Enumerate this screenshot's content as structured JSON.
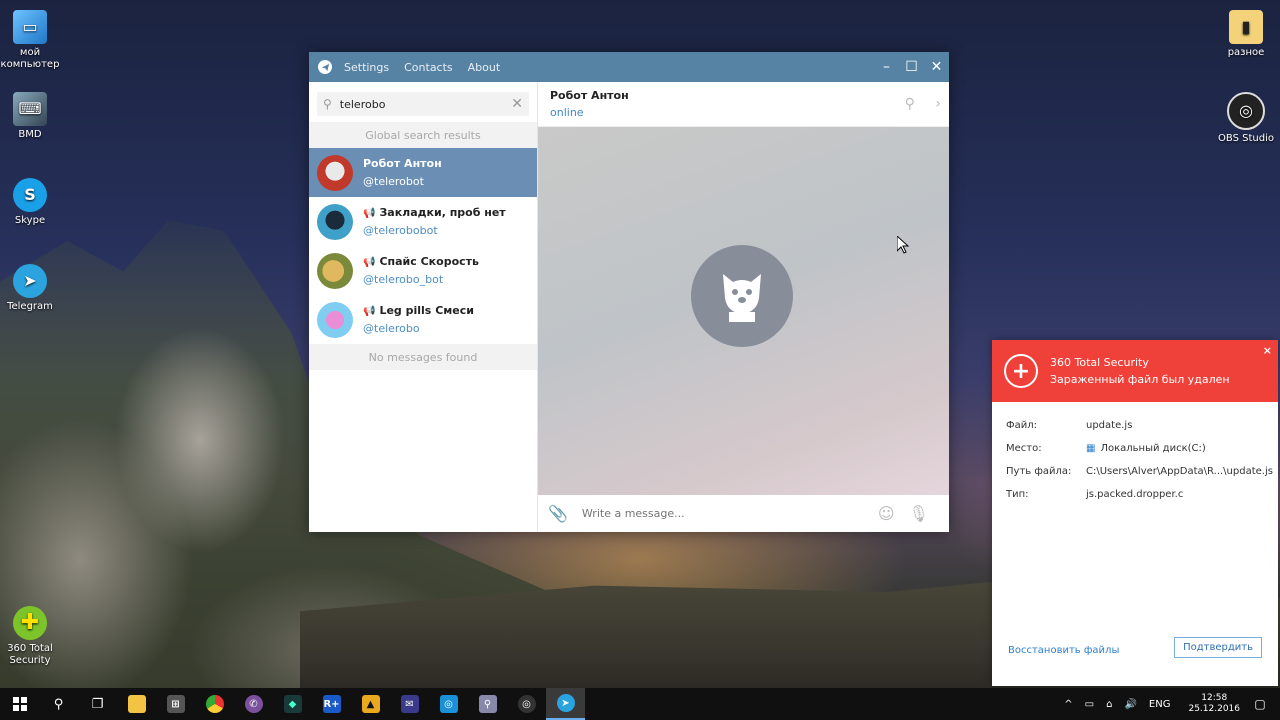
{
  "desktop": {
    "icons_left": [
      {
        "label": "мой компьютер",
        "icon": "computer-icon"
      },
      {
        "label": "BMD",
        "icon": "keyboard-icon"
      },
      {
        "label": "Skype",
        "icon": "skype-icon"
      },
      {
        "label": "Telegram",
        "icon": "telegram-icon"
      },
      {
        "label": "360 Total Security",
        "icon": "security-icon"
      }
    ],
    "icons_right": [
      {
        "label": "разное",
        "icon": "folder-icon"
      },
      {
        "label": "OBS Studio",
        "icon": "obs-icon"
      }
    ]
  },
  "telegram": {
    "menu": {
      "settings": "Settings",
      "contacts": "Contacts",
      "about": "About"
    },
    "search": {
      "value": "telerobo"
    },
    "global_header": "Global search results",
    "results": [
      {
        "name": "Робот Антон",
        "username": "@telerobot",
        "channel": false,
        "active": true,
        "avatar_color": "#c0392b"
      },
      {
        "name": "Закладки, проб нет",
        "username": "@telerobobot",
        "channel": true,
        "active": false,
        "avatar_color": "#3fa0c8"
      },
      {
        "name": "Спайс Скорость",
        "username": "@telerobo_bot",
        "channel": true,
        "active": false,
        "avatar_color": "#c89a3a"
      },
      {
        "name": "Leg pills Смеси",
        "username": "@telerobo",
        "channel": true,
        "active": false,
        "avatar_color": "#b06fd0"
      }
    ],
    "no_messages": "No messages found",
    "chat": {
      "name": "Робот Антон",
      "status": "online",
      "composer_placeholder": "Write a message..."
    }
  },
  "notification": {
    "app": "360 Total Security",
    "message": "Зараженный файл был удален",
    "close": "×",
    "rows": [
      {
        "key": "Файл:",
        "value": "update.js"
      },
      {
        "key": "Место:",
        "value": "Локальный диск(C:)"
      },
      {
        "key": "Путь файла:",
        "value": "C:\\Users\\Alver\\AppData\\R...\\update.js"
      },
      {
        "key": "Тип:",
        "value": "js.packed.dropper.c"
      }
    ],
    "restore": "Восстановить файлы",
    "confirm": "Подтвердить"
  },
  "taskbar": {
    "lang": "ENG",
    "time": "12:58",
    "date": "25.12.2016"
  }
}
